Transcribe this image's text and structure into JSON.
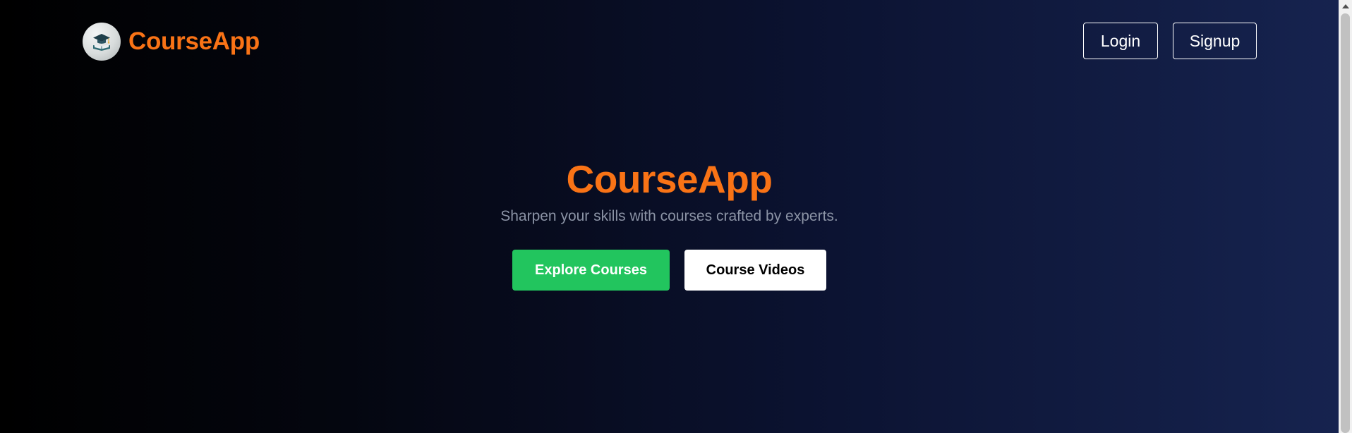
{
  "header": {
    "brand_name": "CourseApp",
    "logo_icon": "graduation-cap-book-icon",
    "login_label": "Login",
    "signup_label": "Signup"
  },
  "hero": {
    "title": "CourseApp",
    "subtitle": "Sharpen your skills with courses crafted by experts.",
    "primary_button_label": "Explore Courses",
    "secondary_button_label": "Course Videos"
  },
  "colors": {
    "brand_orange": "#f97316",
    "primary_green": "#22c55e",
    "background_dark": "#000000",
    "background_navy": "#16234f",
    "subtitle_gray": "#8b93a5"
  }
}
